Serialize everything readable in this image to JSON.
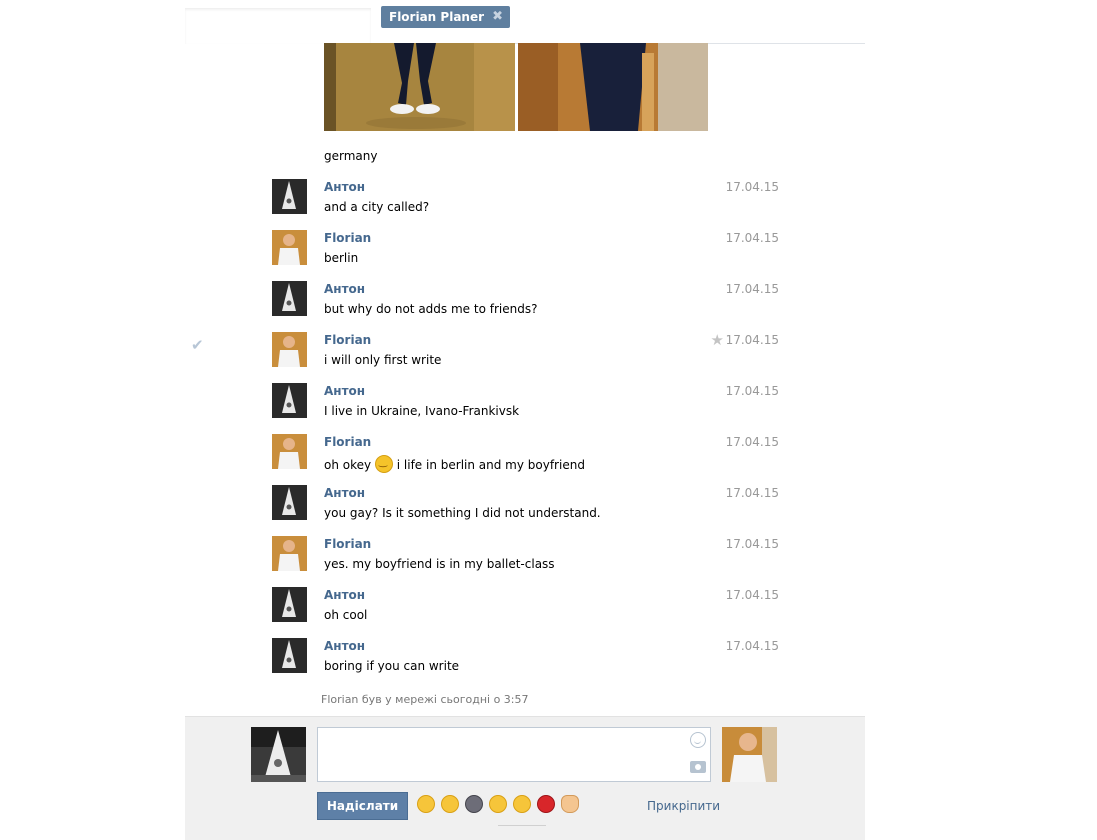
{
  "header": {
    "tab_label": "Florian Planer",
    "close_glyph": "✖"
  },
  "messages": {
    "first_text": "germany",
    "items": [
      {
        "author": "Антон",
        "text": "and a city called?",
        "date": "17.04.15",
        "sender": "anton"
      },
      {
        "author": "Florian",
        "text": "berlin",
        "date": "17.04.15",
        "sender": "florian"
      },
      {
        "author": "Антон",
        "text": "but why do not adds me to friends?",
        "date": "17.04.15",
        "sender": "anton"
      },
      {
        "author": "Florian",
        "text": "i will only first write",
        "date": "17.04.15",
        "sender": "florian",
        "selected": true
      },
      {
        "author": "Антон",
        "text": "I live in Ukraine, Ivano-Frankivsk",
        "date": "17.04.15",
        "sender": "anton"
      },
      {
        "author": "Florian",
        "text_before": "oh okey",
        "text_after": "i life in berlin and my boyfriend",
        "date": "17.04.15",
        "sender": "florian",
        "emoji": "smile-emoji"
      },
      {
        "author": "Антон",
        "text": "you gay? Is it something I did not understand.",
        "date": "17.04.15",
        "sender": "anton"
      },
      {
        "author": "Florian",
        "text": "yes. my boyfriend is in my ballet-class",
        "date": "17.04.15",
        "sender": "florian"
      },
      {
        "author": "Антон",
        "text": "oh cool",
        "date": "17.04.15",
        "sender": "anton"
      },
      {
        "author": "Антон",
        "text": "boring if you can write",
        "date": "17.04.15",
        "sender": "anton"
      }
    ],
    "status": "Florian був у мережі сьогодні о 3:57"
  },
  "compose": {
    "send_label": "Надіслати",
    "attach_label": "Прикріпити",
    "emoji_icons": [
      "rolling-eyes-emoji",
      "confused-emoji",
      "dark-face-emoji",
      "kiss-emoji",
      "grimace-emoji",
      "18-plus-emoji",
      "hand-emoji"
    ]
  },
  "colors": {
    "link": "#45688e",
    "button": "#5e80a7",
    "date": "#999999"
  }
}
